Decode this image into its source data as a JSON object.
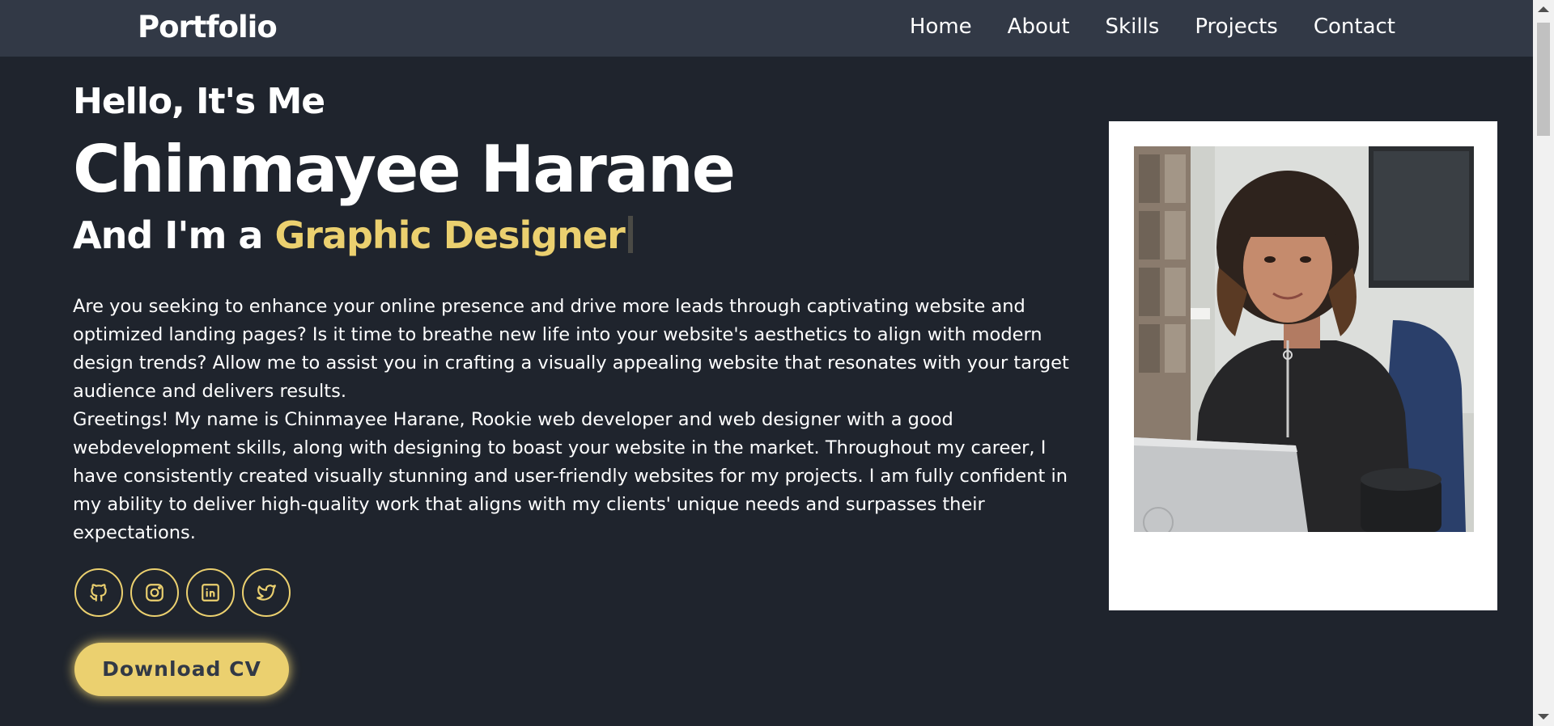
{
  "nav": {
    "logo": "Portfolio",
    "links": [
      "Home",
      "About",
      "Skills",
      "Projects",
      "Contact"
    ]
  },
  "hero": {
    "greeting": "Hello, It's Me",
    "name": "Chinmayee Harane",
    "role_prefix": "And I'm a ",
    "role_typed": "Graphic Designer",
    "bio": "Are you seeking to enhance your online presence and drive more leads through captivating website and optimized landing pages? Is it time to breathe new life into your website's aesthetics to align with modern design trends? Allow me to assist you in crafting a visually appealing website that resonates with your target audience and delivers results.",
    "bio2": "Greetings! My name is Chinmayee Harane, Rookie web developer and web designer with a good webdevelopment skills, along with designing to boast your website in the market. Throughout my career, I have consistently created visually stunning and user-friendly websites for my projects. I am fully confident in my ability to deliver high-quality work that aligns with my clients' unique needs and surpasses their expectations.",
    "download_label": "Download CV"
  },
  "social_icons": [
    "github-icon",
    "instagram-icon",
    "linkedin-icon",
    "twitter-icon"
  ],
  "colors": {
    "background": "#1f242d",
    "navbar": "#323946",
    "accent": "#ebd06f",
    "text": "#ffffff"
  }
}
